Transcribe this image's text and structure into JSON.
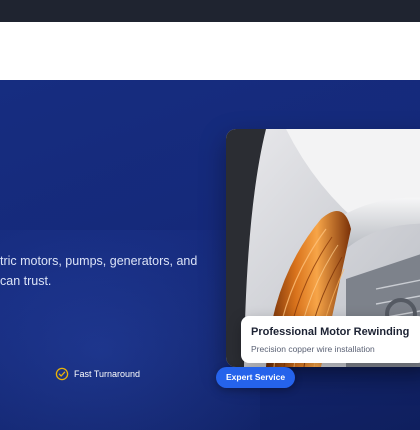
{
  "hero": {
    "description": "tric motors, pumps, generators, and\ncan trust.",
    "features": [
      {
        "icon": "check-circle-icon",
        "label": "Fast Turnaround"
      }
    ]
  },
  "image_card": {
    "image": "motor-rewinding-photo",
    "caption_title": "Professional Motor Rewinding",
    "caption_subtitle": "Precision copper wire installation",
    "badge": "Expert Service"
  },
  "colors": {
    "hero_bg": "#15297a",
    "accent": "#2563eb",
    "check_icon": "#eab308"
  }
}
